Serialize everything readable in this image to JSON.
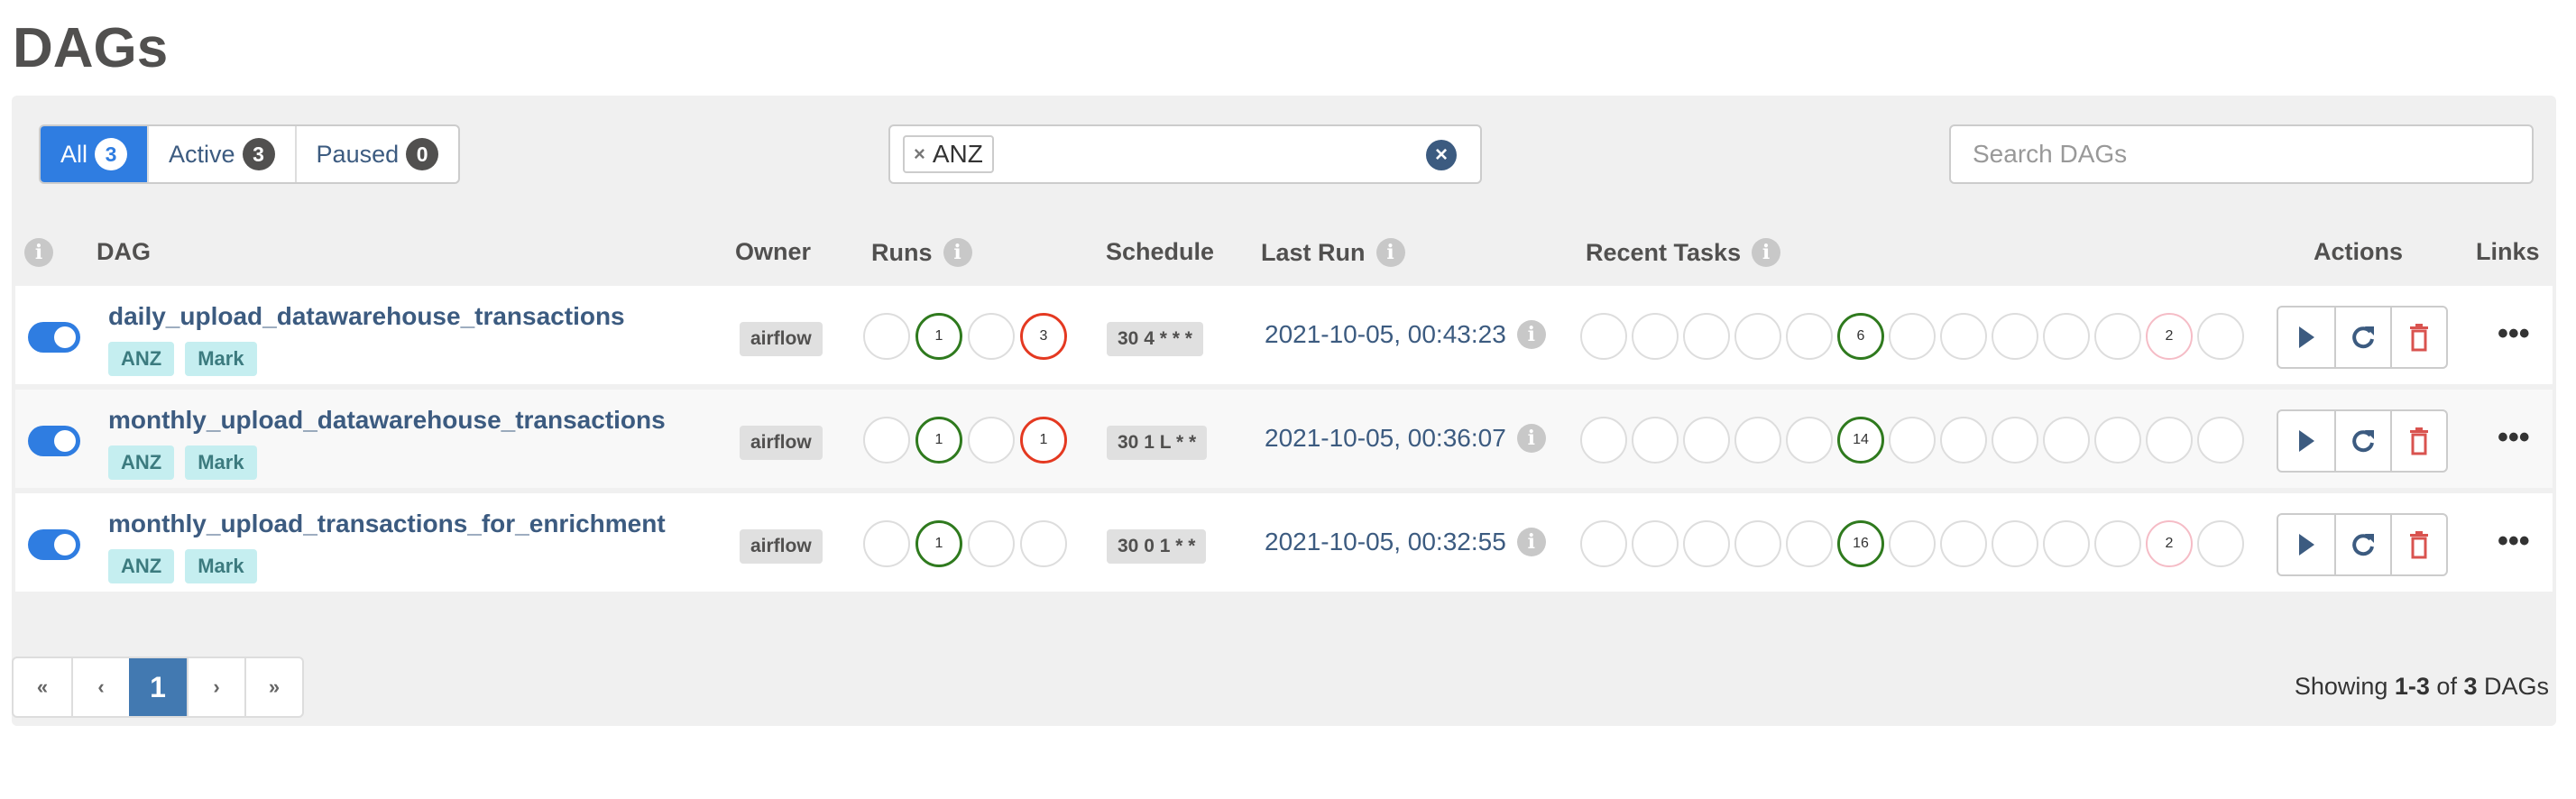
{
  "title": "DAGs",
  "filters": [
    {
      "label": "All",
      "count": "3",
      "active": true
    },
    {
      "label": "Active",
      "count": "3"
    },
    {
      "label": "Paused",
      "count": "0"
    }
  ],
  "tag_filter": {
    "chip": "ANZ",
    "remove": "×",
    "clear": "×"
  },
  "search": {
    "placeholder": "Search DAGs",
    "value": ""
  },
  "columns": {
    "dag": "DAG",
    "owner": "Owner",
    "runs": "Runs",
    "schedule": "Schedule",
    "last_run": "Last Run",
    "recent_tasks": "Recent Tasks",
    "actions": "Actions",
    "links": "Links"
  },
  "colors": {
    "success": "#2f7a1e",
    "failed": "#e43921",
    "upstream_failed": "#f5bcc6",
    "empty": "#dddddd",
    "accent": "#2f7de1"
  },
  "rows": [
    {
      "name": "daily_upload_datawarehouse_transactions",
      "tags": [
        "ANZ",
        "Mark"
      ],
      "owner": "airflow",
      "schedule": "30 4 * * *",
      "last_run": "2021-10-05, 00:43:23",
      "enabled": true,
      "runs": [
        {
          "n": ""
        },
        {
          "n": "1",
          "s": "success"
        },
        {
          "n": ""
        },
        {
          "n": "3",
          "s": "failed"
        }
      ],
      "tasks": [
        {
          "n": ""
        },
        {
          "n": ""
        },
        {
          "n": ""
        },
        {
          "n": ""
        },
        {
          "n": ""
        },
        {
          "n": "6",
          "s": "success"
        },
        {
          "n": ""
        },
        {
          "n": ""
        },
        {
          "n": ""
        },
        {
          "n": ""
        },
        {
          "n": ""
        },
        {
          "n": "2",
          "s": "upstream_failed"
        },
        {
          "n": ""
        }
      ]
    },
    {
      "name": "monthly_upload_datawarehouse_transactions",
      "tags": [
        "ANZ",
        "Mark"
      ],
      "owner": "airflow",
      "schedule": "30 1 L * *",
      "last_run": "2021-10-05, 00:36:07",
      "enabled": true,
      "runs": [
        {
          "n": ""
        },
        {
          "n": "1",
          "s": "success"
        },
        {
          "n": ""
        },
        {
          "n": "1",
          "s": "failed"
        }
      ],
      "tasks": [
        {
          "n": ""
        },
        {
          "n": ""
        },
        {
          "n": ""
        },
        {
          "n": ""
        },
        {
          "n": ""
        },
        {
          "n": "14",
          "s": "success"
        },
        {
          "n": ""
        },
        {
          "n": ""
        },
        {
          "n": ""
        },
        {
          "n": ""
        },
        {
          "n": ""
        },
        {
          "n": ""
        },
        {
          "n": ""
        }
      ]
    },
    {
      "name": "monthly_upload_transactions_for_enrichment",
      "tags": [
        "ANZ",
        "Mark"
      ],
      "owner": "airflow",
      "schedule": "30 0 1 * *",
      "last_run": "2021-10-05, 00:32:55",
      "enabled": true,
      "runs": [
        {
          "n": ""
        },
        {
          "n": "1",
          "s": "success"
        },
        {
          "n": ""
        },
        {
          "n": ""
        }
      ],
      "tasks": [
        {
          "n": ""
        },
        {
          "n": ""
        },
        {
          "n": ""
        },
        {
          "n": ""
        },
        {
          "n": ""
        },
        {
          "n": "16",
          "s": "success"
        },
        {
          "n": ""
        },
        {
          "n": ""
        },
        {
          "n": ""
        },
        {
          "n": ""
        },
        {
          "n": ""
        },
        {
          "n": "2",
          "s": "upstream_failed"
        },
        {
          "n": ""
        }
      ]
    }
  ],
  "pagination": {
    "first": "«",
    "prev": "‹",
    "current": "1",
    "next": "›",
    "last": "»"
  },
  "showing": {
    "prefix": "Showing ",
    "range": "1-3",
    "mid": " of ",
    "total": "3",
    "suffix": " DAGs"
  }
}
